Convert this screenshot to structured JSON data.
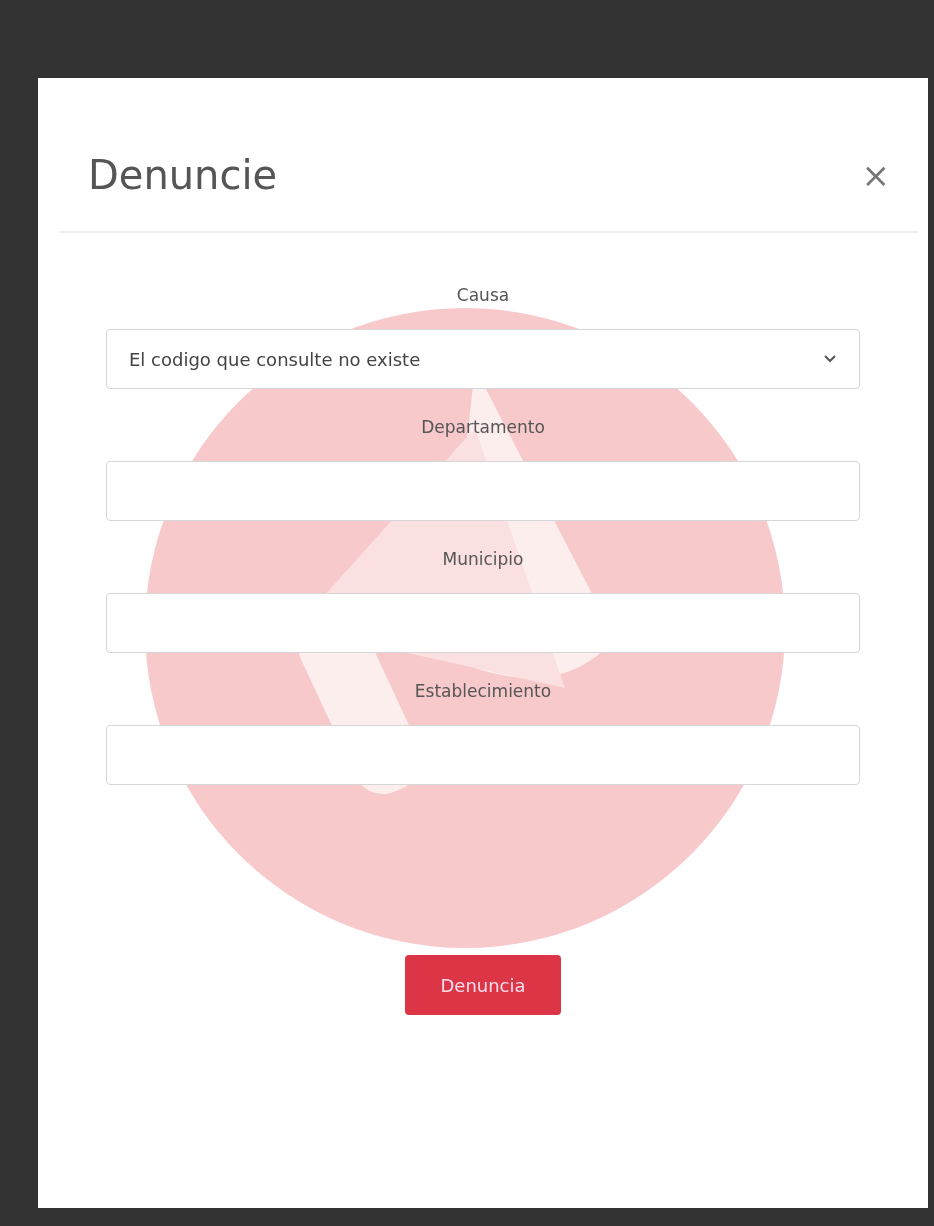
{
  "modal": {
    "title": "Denuncie",
    "close": "×",
    "fields": [
      {
        "kind": "select",
        "label": "Causa",
        "value": "El codigo que consulte no existe"
      },
      {
        "kind": "text",
        "label": "Departamento"
      },
      {
        "kind": "text",
        "label": "Municipio"
      },
      {
        "kind": "text",
        "label": "Establecimiento"
      }
    ],
    "submit_button": {
      "label": "Denuncia"
    }
  }
}
